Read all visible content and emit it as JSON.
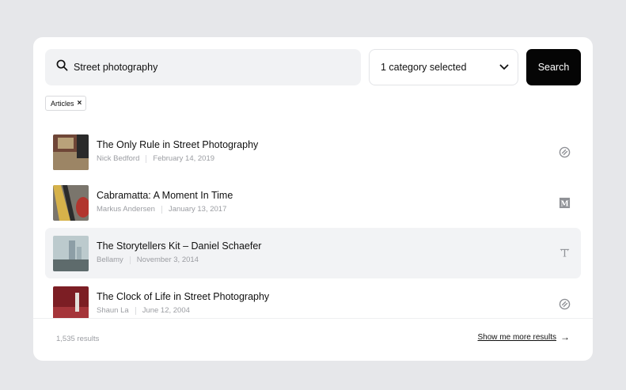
{
  "search": {
    "query": "Street photography",
    "placeholder": "",
    "category_label": "1 category selected",
    "button_label": "Search"
  },
  "filters": [
    {
      "label": "Articles",
      "remove": "×"
    }
  ],
  "results": [
    {
      "title": "The Only Rule in Street Photography",
      "author": "Nick Bedford",
      "date": "February 14, 2019",
      "source_icon": "squarespace-logo-icon",
      "thumb_colors": [
        "#7a4b3a",
        "#b89a6e",
        "#2f2f2f"
      ]
    },
    {
      "title": "Cabramatta: A Moment In Time",
      "author": "Markus Andersen",
      "date": "January 13, 2017",
      "source_icon": "medium-logo-icon",
      "thumb_colors": [
        "#a03a35",
        "#d4b04a",
        "#6e6a62"
      ]
    },
    {
      "title": "The Storytellers Kit – Daniel Schaefer",
      "author": "Bellamy",
      "date": "November 3, 2014",
      "source_icon": "nytimes-logo-icon",
      "thumb_colors": [
        "#8ea3ae",
        "#c7d1d4",
        "#5f6c6d"
      ]
    },
    {
      "title": "The Clock of Life in Street Photography",
      "author": "Shaun La",
      "date": "June 12, 2004",
      "source_icon": "squarespace-logo-icon",
      "thumb_colors": [
        "#7c1e24",
        "#b03a3a",
        "#e4e0da"
      ]
    }
  ],
  "footer": {
    "count": "1,535 results",
    "more_label": "Show me more results",
    "more_arrow": "→"
  },
  "colors": {
    "background": "#e6e7ea",
    "card": "#ffffff",
    "button": "#050505",
    "highlight_row": "#f2f3f5",
    "muted_text": "#9b9da2"
  }
}
